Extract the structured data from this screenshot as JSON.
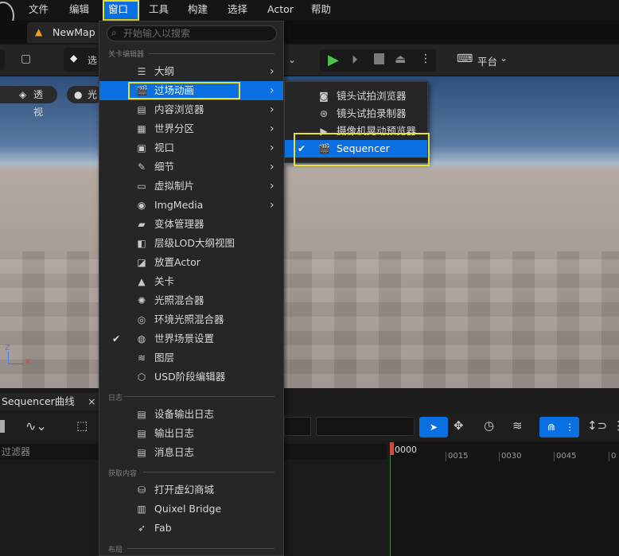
{
  "menubar": {
    "items": [
      "文件",
      "编辑",
      "窗口",
      "工具",
      "构建",
      "选择",
      "Actor",
      "帮助"
    ],
    "active": "窗口"
  },
  "tab": {
    "label": "NewMap"
  },
  "toolbar": {
    "select_label": "选",
    "platform_label": "平台"
  },
  "viewport": {
    "perspective_label": "透视",
    "lit_label": "光"
  },
  "search": {
    "placeholder": "开始输入以搜索"
  },
  "main_menu": {
    "section_level_editor": "关卡编辑器",
    "items": [
      {
        "label": "大纲",
        "icon": "outline-icon",
        "submenu": true
      },
      {
        "label": "过场动画",
        "icon": "cinematics-icon",
        "submenu": true,
        "highlighted": true
      },
      {
        "label": "内容浏览器",
        "icon": "content-browser-icon",
        "submenu": true
      },
      {
        "label": "世界分区",
        "icon": "world-partition-icon",
        "submenu": true
      },
      {
        "label": "视口",
        "icon": "viewport-icon",
        "submenu": true
      },
      {
        "label": "细节",
        "icon": "details-icon",
        "submenu": true
      },
      {
        "label": "虚拟制片",
        "icon": "virtual-production-icon",
        "submenu": true
      },
      {
        "label": "ImgMedia",
        "icon": "imgmedia-icon",
        "submenu": true
      },
      {
        "label": "变体管理器",
        "icon": "variant-manager-icon"
      },
      {
        "label": "层级LOD大纲视图",
        "icon": "hlod-icon"
      },
      {
        "label": "放置Actor",
        "icon": "place-actor-icon"
      },
      {
        "label": "关卡",
        "icon": "levels-icon"
      },
      {
        "label": "光照混合器",
        "icon": "light-mixer-icon"
      },
      {
        "label": "环境光照混合器",
        "icon": "env-light-mixer-icon"
      },
      {
        "label": "世界场景设置",
        "icon": "world-settings-icon",
        "checked": true
      },
      {
        "label": "图层",
        "icon": "layers-icon"
      },
      {
        "label": "USD阶段编辑器",
        "icon": "usd-icon"
      }
    ],
    "section_log": "日志",
    "log_items": [
      {
        "label": "设备输出日志",
        "icon": "device-log-icon"
      },
      {
        "label": "输出日志",
        "icon": "output-log-icon"
      },
      {
        "label": "消息日志",
        "icon": "message-log-icon"
      }
    ],
    "section_get_content": "获取内容",
    "content_items": [
      {
        "label": "打开虚幻商城",
        "icon": "marketplace-icon"
      },
      {
        "label": "Quixel Bridge",
        "icon": "bridge-icon"
      },
      {
        "label": "Fab",
        "icon": "fab-icon"
      }
    ],
    "section_layout": "布局"
  },
  "sub_menu": {
    "items": [
      {
        "label": "镜头试拍浏览器",
        "icon": "take-browser-icon"
      },
      {
        "label": "镜头试拍录制器",
        "icon": "take-recorder-icon"
      },
      {
        "label": "摄像机晃动预览器",
        "icon": "camera-shake-icon"
      },
      {
        "label": "Sequencer",
        "icon": "sequencer-icon",
        "checked": true,
        "highlighted": true
      }
    ]
  },
  "bottom_panel": {
    "tab_label": "Sequencer曲线",
    "filter_placeholder": "过滤器",
    "ticks": [
      "0000",
      "0015",
      "0030",
      "0045",
      "0"
    ]
  },
  "colors": {
    "accent": "#0a6fe0",
    "highlight_box": "#e8e02a"
  }
}
